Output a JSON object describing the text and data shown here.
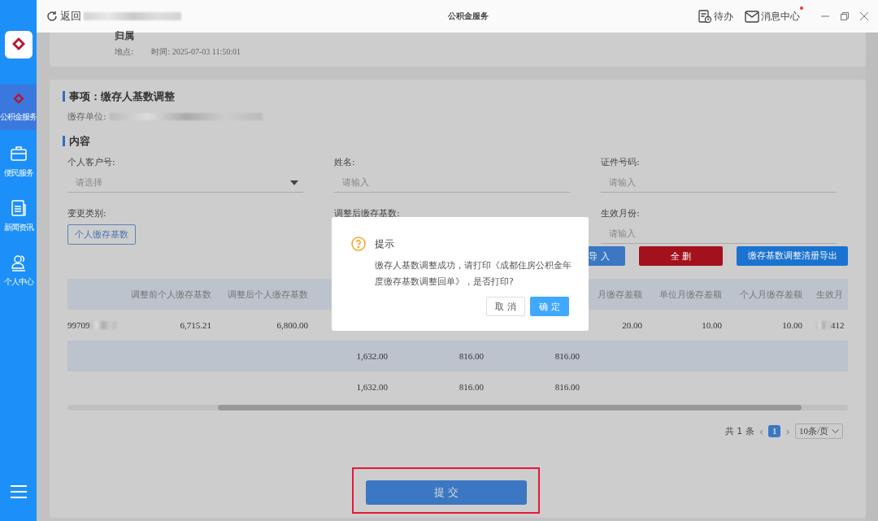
{
  "titlebar": {
    "back": "返回",
    "title": "公积金服务",
    "todo": "待办",
    "messages": "消息中心",
    "messages_unread": true
  },
  "sidebar": {
    "items": [
      {
        "label": "公积金服务",
        "selected": true
      },
      {
        "label": "便民服务",
        "selected": false
      },
      {
        "label": "新闻资讯",
        "selected": false
      },
      {
        "label": "个人中心",
        "selected": false
      }
    ]
  },
  "record": {
    "title": "归属",
    "place_label": "地点:",
    "time": "时间: 2025-07-03 11:50:01"
  },
  "section_title": "事项：缴存人基数调整",
  "unit_label": "缴存单位:",
  "content_title": "内容",
  "form": [
    {
      "label": "个人客户号:",
      "kind": "select",
      "placeholder": "请选择"
    },
    {
      "label": "姓名:",
      "kind": "input",
      "placeholder": "请输入"
    },
    {
      "label": "证件号码:",
      "kind": "input",
      "placeholder": "请输入"
    },
    {
      "label": "变更类别:",
      "kind": "tag",
      "value": "个人缴存基数"
    },
    {
      "label": "调整后缴存基数:",
      "kind": "hidden"
    },
    {
      "label": "生效月份:",
      "kind": "input",
      "placeholder": "请输入"
    }
  ],
  "actions": [
    {
      "label": "导 入",
      "kind": "primary"
    },
    {
      "label": "全 删",
      "kind": "danger"
    },
    {
      "label": "缴存基数调整清册导出",
      "kind": "primary"
    }
  ],
  "table": {
    "columns": [
      null,
      "调整前个人缴存基数",
      "调整后个人缴存基数",
      null,
      null,
      null,
      "月缴存差额",
      "单位月缴存差额",
      "个人月缴存差额",
      "生效月"
    ],
    "rows": [
      {
        "cells": [
          "99709",
          "6,715.21",
          "6,800.00",
          null,
          null,
          null,
          "20.00",
          "10.00",
          "10.00",
          "412"
        ]
      },
      {
        "cells": [
          null,
          null,
          null,
          "1,632.00",
          "816.00",
          "816.00",
          null,
          null,
          null,
          null
        ]
      },
      {
        "cells": [
          null,
          null,
          null,
          "1,632.00",
          "816.00",
          "816.00",
          null,
          null,
          null,
          null
        ]
      }
    ]
  },
  "pagination": {
    "total": "共 1 条",
    "prev": "‹",
    "next": "›",
    "pages": [
      {
        "label": "1",
        "selected": true
      }
    ],
    "page_size": "10条/页"
  },
  "submit": "提 交",
  "dialog": {
    "title": "提示",
    "message": "缴存人基数调整成功，请打印《成都住房公积金年度缴存基数调整回单》，是否打印?",
    "buttons": [
      {
        "label": "取 消",
        "kind": "default"
      },
      {
        "label": "确 定",
        "kind": "primary"
      }
    ]
  }
}
